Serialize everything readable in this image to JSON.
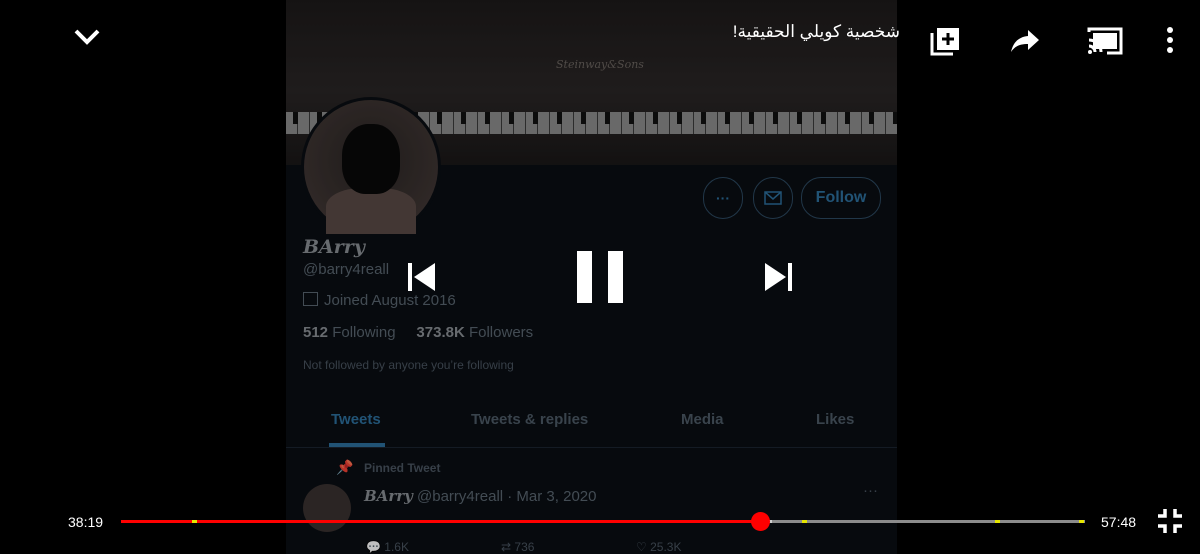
{
  "player": {
    "video_title": "شخصية كويلي الحقيقية!",
    "current_time": "38:19",
    "duration": "57:48",
    "progress_fraction": 0.663,
    "buffered_fraction": 0.675,
    "chapter_markers_fraction": [
      0.077,
      0.71,
      0.91,
      0.997
    ],
    "icons": {
      "minimize": "chevron-down-icon",
      "add_to_queue": "add-to-queue-icon",
      "share": "share-icon",
      "cast": "cast-icon",
      "more": "more-vertical-icon",
      "previous": "skip-previous-icon",
      "pause": "pause-icon",
      "next": "skip-next-icon",
      "exit_fullscreen": "exit-fullscreen-icon"
    },
    "accent_color": "#ff0000"
  },
  "video_frame": {
    "banner_brand": "Steinway&Sons",
    "profile": {
      "name": "BArry",
      "handle": "@barry4reall",
      "joined": "Joined August 2016",
      "following_count": "512",
      "following_label": "Following",
      "followers_count": "373.8K",
      "followers_label": "Followers",
      "not_followed": "Not followed by anyone you’re following",
      "follow_button": "Follow",
      "more_button": "···"
    },
    "tabs": [
      "Tweets",
      "Tweets & replies",
      "Media",
      "Likes"
    ],
    "active_tab": "Tweets",
    "pinned_label": "Pinned Tweet",
    "tweet": {
      "name": "BArry",
      "handle_date": "@barry4reall · Mar 3, 2020",
      "more": "···",
      "replies": "1.6K",
      "retweets": "736",
      "likes": "25.3K"
    }
  }
}
